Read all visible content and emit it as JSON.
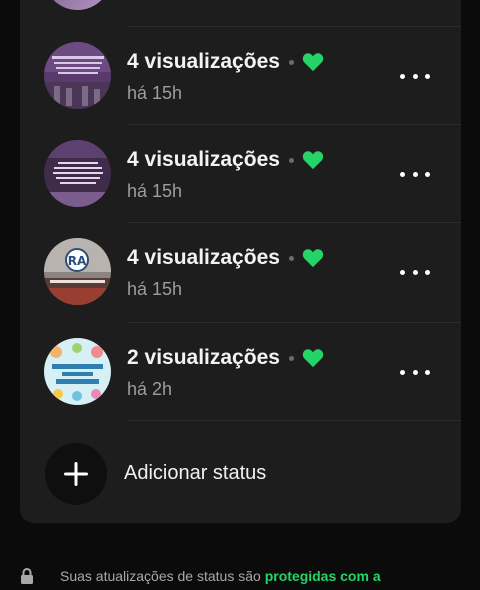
{
  "status_list": {
    "items": [
      {
        "views": "4 visualizações",
        "time": "há 15h",
        "thumb_colors": [
          "#5e3b6e",
          "#a07cb5"
        ]
      },
      {
        "views": "4 visualizações",
        "time": "há 15h",
        "thumb_colors": [
          "#3b2a44",
          "#8c5ea0"
        ]
      },
      {
        "views": "4 visualizações",
        "time": "há 15h",
        "thumb_colors": [
          "#6e5c56",
          "#b9b2ad"
        ]
      },
      {
        "views": "2 visualizações",
        "time": "há 2h",
        "thumb_colors": [
          "#cdeaf0",
          "#7fcce0"
        ]
      }
    ]
  },
  "add_status": {
    "label": "Adicionar status"
  },
  "footer": {
    "text": "Suas atualizações de status são ",
    "link": "protegidas com a"
  },
  "colors": {
    "accent": "#25d366",
    "card_bg": "#1d1d1d",
    "page_bg": "#0b0b0b"
  },
  "icons": [
    "heart-icon",
    "more-options-icon",
    "plus-icon",
    "lock-icon"
  ]
}
